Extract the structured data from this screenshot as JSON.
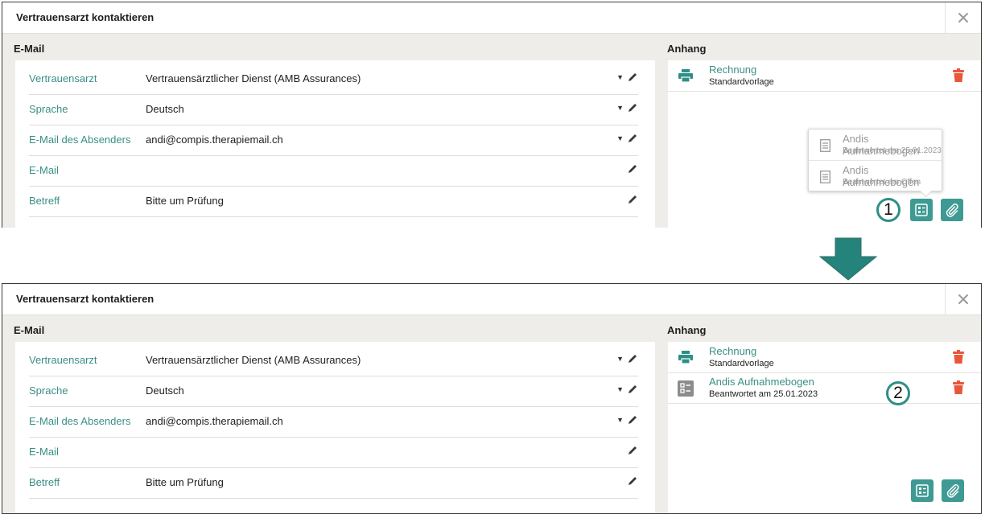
{
  "dialog_title": "Vertrauensarzt kontaktieren",
  "email_section_label": "E-Mail",
  "attachment_section_label": "Anhang",
  "fields": [
    {
      "label": "Vertrauensarzt",
      "value": "Vertrauensärztlicher Dienst (AMB Assurances)",
      "has_dropdown": true
    },
    {
      "label": "Sprache",
      "value": "Deutsch",
      "has_dropdown": true
    },
    {
      "label": "E-Mail des Absenders",
      "value": "andi@compis.therapiemail.ch",
      "has_dropdown": true
    },
    {
      "label": "E-Mail",
      "value": "",
      "has_dropdown": false
    },
    {
      "label": "Betreff",
      "value": "Bitte um Prüfung",
      "has_dropdown": false
    }
  ],
  "before": {
    "attachments": [
      {
        "name": "Rechnung",
        "subtitle": "Standardvorlage",
        "icon": "printer-icon"
      }
    ],
    "questionnaire_menu": [
      {
        "name": "Andis Aufnahmebogen",
        "subtitle": "Beantwortet am 25.01.2023",
        "icon": "document-icon"
      },
      {
        "name": "Andis Aufnahmebogen",
        "subtitle": "Beantwortet am Offen",
        "icon": "document-icon"
      }
    ],
    "step_marker": "1"
  },
  "after": {
    "attachments": [
      {
        "name": "Rechnung",
        "subtitle": "Standardvorlage",
        "icon": "printer-icon"
      },
      {
        "name": "Andis Aufnahmebogen",
        "subtitle": "Beantwortet am 25.01.2023",
        "icon": "form-icon"
      }
    ],
    "step_marker": "2"
  },
  "colors": {
    "accent": "#3e9a92",
    "link": "#3a8f87",
    "delete": "#e8573a",
    "arrow": "#24837a",
    "panel_bg": "#efedea"
  }
}
